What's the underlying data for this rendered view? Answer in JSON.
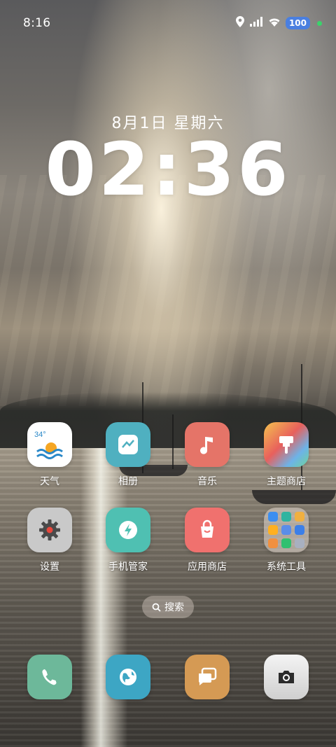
{
  "status_bar": {
    "time": "8:16",
    "battery": "100"
  },
  "lockclock": {
    "date": "8月1日  星期六",
    "time": "02:36"
  },
  "weather_icon_temp": "34°",
  "apps_row1": [
    {
      "label": "天气",
      "icon": "weather-icon",
      "color": "#ffffff"
    },
    {
      "label": "相册",
      "icon": "gallery-icon",
      "color": "#4fb0c0"
    },
    {
      "label": "音乐",
      "icon": "music-icon",
      "color": "#e57468"
    },
    {
      "label": "主题商店",
      "icon": "theme-store-icon",
      "color": "#f2a75a"
    }
  ],
  "apps_row2": [
    {
      "label": "设置",
      "icon": "gear-icon",
      "color": "#c9c9c9"
    },
    {
      "label": "手机管家",
      "icon": "phone-manager-icon",
      "color": "#4fc0b2"
    },
    {
      "label": "应用商店",
      "icon": "app-store-icon",
      "color": "#f0716e"
    },
    {
      "label": "系统工具",
      "icon": "system-tools-folder-icon",
      "color": "#d8d0c8"
    }
  ],
  "folder_mini_icons": [
    "#3c8ef0",
    "#2fb4a0",
    "#f0b040",
    "#ffb020",
    "#5a8de8",
    "#3c7fe8",
    "#f09040",
    "#30c070",
    "#a8b0c0"
  ],
  "search": {
    "label": "搜索"
  },
  "dock": [
    {
      "name": "phone",
      "icon": "phone-icon",
      "color": "#6db89a"
    },
    {
      "name": "browser",
      "icon": "globe-icon",
      "color": "#3da6c4"
    },
    {
      "name": "messages",
      "icon": "messages-icon",
      "color": "#d59a54"
    },
    {
      "name": "camera",
      "icon": "camera-icon",
      "color": "#e8e8e8"
    }
  ]
}
